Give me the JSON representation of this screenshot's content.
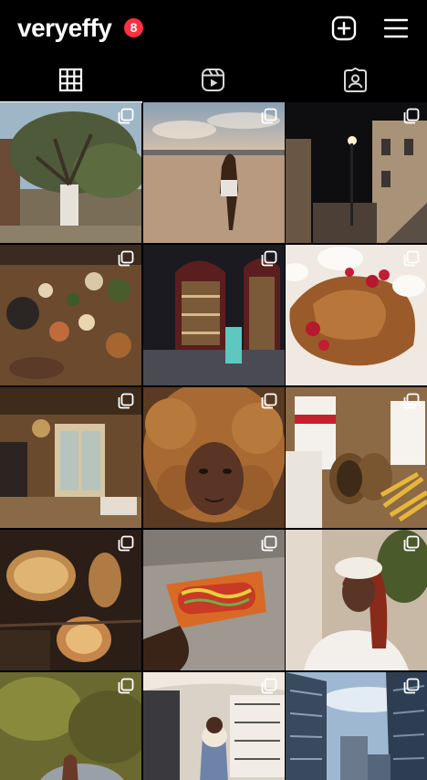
{
  "profile": {
    "username": "veryeffy",
    "notification_count": "8"
  },
  "header_icons": {
    "create": "plus-square-icon",
    "menu": "hamburger-menu-icon"
  },
  "tabs": [
    {
      "name": "posts-grid",
      "icon": "grid-icon",
      "active": true
    },
    {
      "name": "reels",
      "icon": "reels-icon",
      "active": false
    },
    {
      "name": "tagged",
      "icon": "tagged-person-icon",
      "active": false
    }
  ],
  "posts": [
    {
      "subject": "tree-in-courtyard",
      "carousel": true
    },
    {
      "subject": "woman-at-sunset-waterfront",
      "carousel": true
    },
    {
      "subject": "night-street-lamp",
      "carousel": true
    },
    {
      "subject": "korean-bbq-table",
      "carousel": true
    },
    {
      "subject": "bar-with-shelves",
      "carousel": true
    },
    {
      "subject": "french-toast-with-cream",
      "carousel": true
    },
    {
      "subject": "cafe-interior",
      "carousel": true
    },
    {
      "subject": "curly-hair-selfie",
      "carousel": true
    },
    {
      "subject": "five-guys-burgers-fries",
      "carousel": true
    },
    {
      "subject": "wicker-lamps",
      "carousel": true
    },
    {
      "subject": "hot-dog-in-hand",
      "carousel": true
    },
    {
      "subject": "woman-in-beret",
      "carousel": true
    },
    {
      "subject": "sunlit-garden-hand",
      "carousel": true
    },
    {
      "subject": "underground-station-walk",
      "carousel": true
    },
    {
      "subject": "city-skyscrapers",
      "carousel": true
    }
  ]
}
